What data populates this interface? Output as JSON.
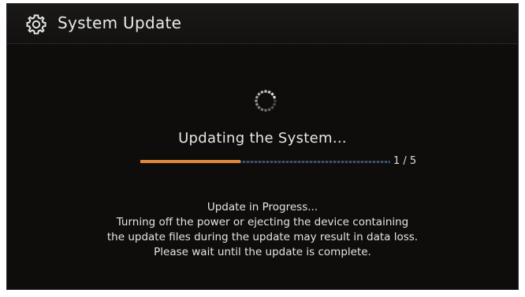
{
  "header": {
    "title": "System Update",
    "icon": "gear-icon"
  },
  "status": {
    "heading": "Updating the System...",
    "spinner_icon": "loading-spinner-icon"
  },
  "progress": {
    "fraction": 0.4,
    "count_text": "1 / 5",
    "fill_color": "#e0873a",
    "track_color": "#3d4f66"
  },
  "message": {
    "lines": [
      "Update in Progress...",
      "Turning off the power or ejecting the device containing",
      "the update files during the update may result in data loss.",
      "Please wait until the update is complete."
    ]
  },
  "colors": {
    "background": "#0f0d0c",
    "text": "#e6e6e6",
    "accent": "#e0873a"
  }
}
